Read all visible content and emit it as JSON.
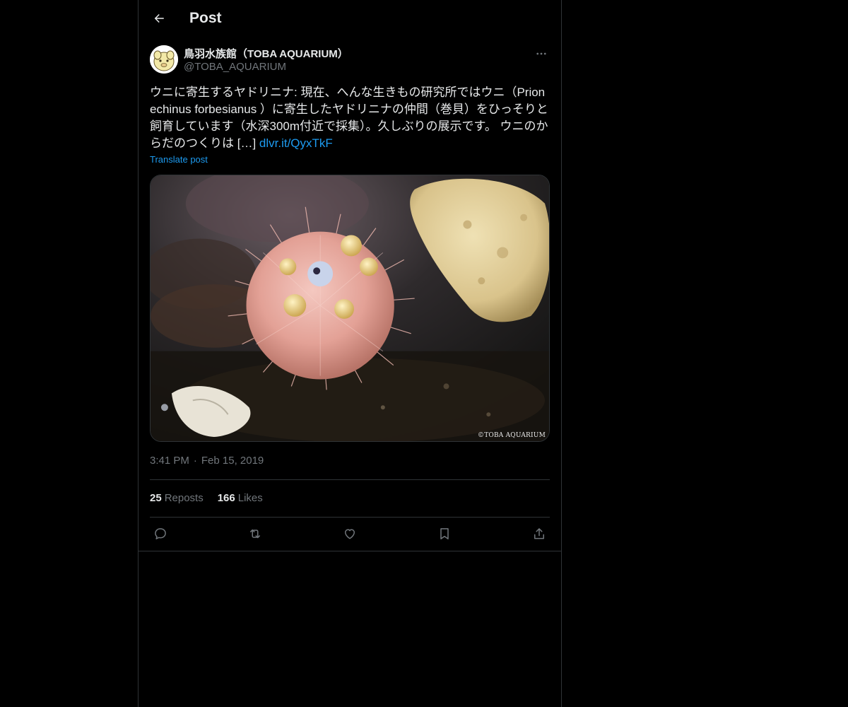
{
  "header": {
    "title": "Post"
  },
  "author": {
    "display_name": "鳥羽水族館（TOBA AQUARIUM）",
    "handle": "@TOBA_AQUARIUM"
  },
  "post": {
    "text": "ウニに寄生するヤドリニナ: 現在、へんな生きもの研究所ではウニ（Prionechinus forbesianus ）に寄生したヤドリニナの仲間（巻貝）をひっそりと飼育しています（水深300m付近で採集）。久しぶりの展示です。 ウニのからだのつくりは […] ",
    "link": "dlvr.it/QyxTkF",
    "translate_label": "Translate post",
    "media_watermark": "©TOBA AQUARIUM",
    "time": "3:41 PM",
    "separator": "·",
    "date": "Feb 15, 2019"
  },
  "stats": {
    "reposts_count": "25",
    "reposts_label": "Reposts",
    "likes_count": "166",
    "likes_label": "Likes"
  },
  "icons": {
    "back": "arrow-left-icon",
    "more": "more-icon",
    "reply": "reply-icon",
    "repost": "repost-icon",
    "like": "heart-icon",
    "bookmark": "bookmark-icon",
    "share": "share-icon"
  },
  "colors": {
    "background": "#000000",
    "text": "#e7e9ea",
    "secondary": "#71767b",
    "accent": "#1d9bf0",
    "border": "#2f3336"
  }
}
